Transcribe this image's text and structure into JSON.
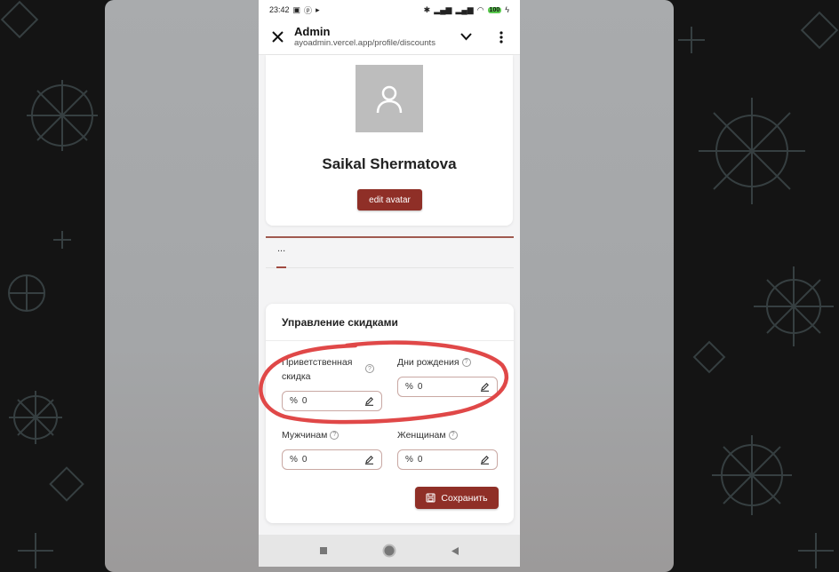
{
  "status_bar": {
    "time": "23:42",
    "battery": "100"
  },
  "browser": {
    "title": "Admin",
    "url": "ayoadmin.vercel.app/profile/discounts"
  },
  "profile": {
    "name": "Saikal Shermatova",
    "edit_avatar_label": "edit avatar"
  },
  "tabs": {
    "active_label": "..."
  },
  "discounts": {
    "title": "Управление скидками",
    "fields": [
      {
        "label": "Приветственная скидка",
        "prefix": "%",
        "value": "0"
      },
      {
        "label": "Дни рождения",
        "prefix": "%",
        "value": "0"
      },
      {
        "label": "Мужчинам",
        "prefix": "%",
        "value": "0"
      },
      {
        "label": "Женщинам",
        "prefix": "%",
        "value": "0"
      }
    ],
    "save_label": "Сохранить"
  },
  "colors": {
    "accent": "#8f2f27",
    "annotation": "#e04848"
  }
}
